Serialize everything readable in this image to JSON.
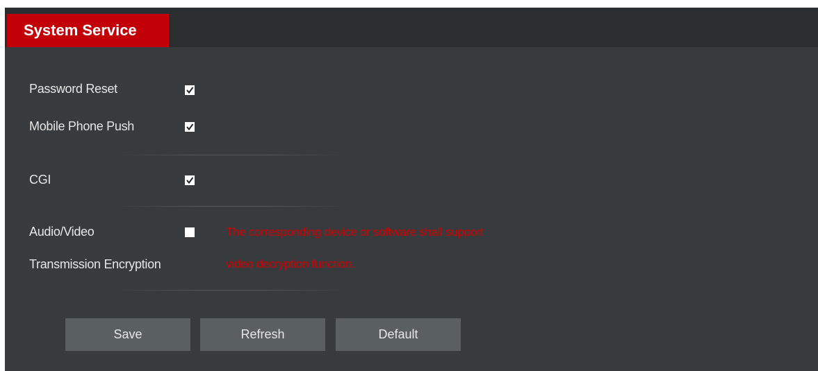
{
  "header": {
    "tab_label": "System Service",
    "accent_color": "#c10007"
  },
  "settings": {
    "password_reset": {
      "label": "Password Reset",
      "checked": true
    },
    "mobile_phone_push": {
      "label": "Mobile Phone Push",
      "checked": true
    },
    "cgi": {
      "label": "CGI",
      "checked": true
    },
    "av_encryption": {
      "label_line1": "Audio/Video",
      "label_line2": "Transmission Encryption",
      "checked": false,
      "note_line1": "The corresponding device or software shall support",
      "note_line2": "video decryption function."
    }
  },
  "buttons": {
    "save": "Save",
    "refresh": "Refresh",
    "default": "Default"
  }
}
